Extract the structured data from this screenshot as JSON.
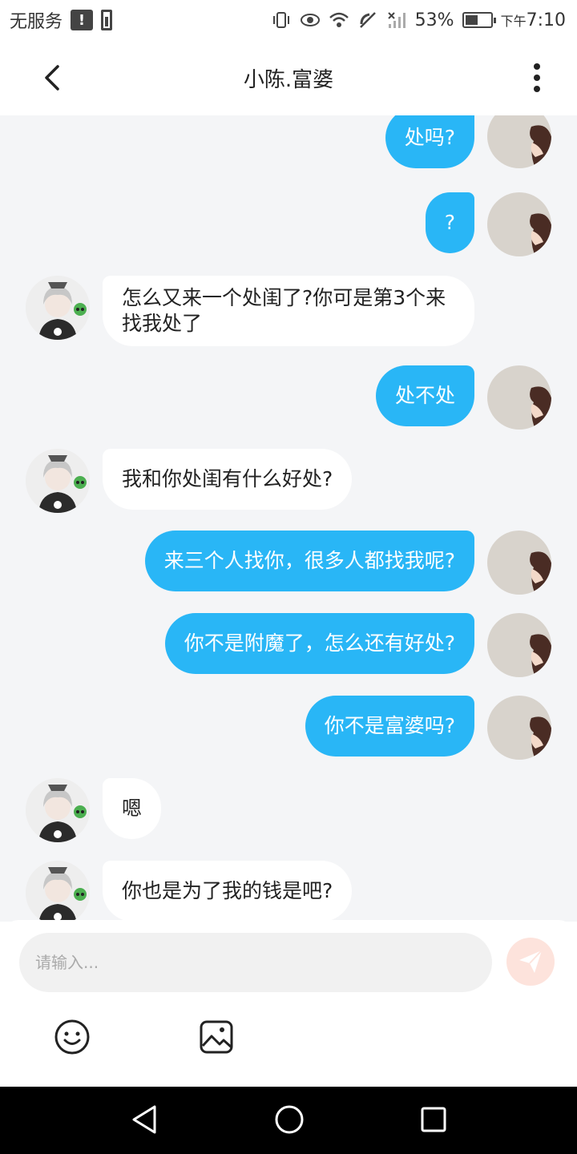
{
  "status_bar": {
    "carrier": "无服务",
    "battery_percent": "53%",
    "time_prefix": "下午",
    "time": "7:10",
    "battery_level": 0.53
  },
  "header": {
    "title": "小陈.富婆",
    "back_icon": "chevron-left-icon",
    "more_icon": "more-vertical-icon"
  },
  "messages": [
    {
      "sender": "me",
      "text": "处吗?"
    },
    {
      "sender": "me",
      "text": "?"
    },
    {
      "sender": "other",
      "text": "怎么又来一个处闺了?你可是第3个来找我处了"
    },
    {
      "sender": "me",
      "text": "处不处"
    },
    {
      "sender": "other",
      "text": "我和你处闺有什么好处?"
    },
    {
      "sender": "me",
      "text": "来三个人找你，很多人都找我呢?"
    },
    {
      "sender": "me",
      "text": "你不是附魔了，怎么还有好处?"
    },
    {
      "sender": "me",
      "text": "你不是富婆吗?"
    },
    {
      "sender": "other",
      "text": "嗯"
    },
    {
      "sender": "other",
      "text": "你也是为了我的钱是吧?"
    }
  ],
  "input": {
    "placeholder": "请输入...",
    "value": ""
  },
  "icons": {
    "send": "send-icon",
    "emoji": "emoji-icon",
    "image": "image-icon"
  },
  "colors": {
    "my_bubble": "#29b6f6",
    "chat_background": "#f4f5f7",
    "send_button": "#fde3dc"
  }
}
